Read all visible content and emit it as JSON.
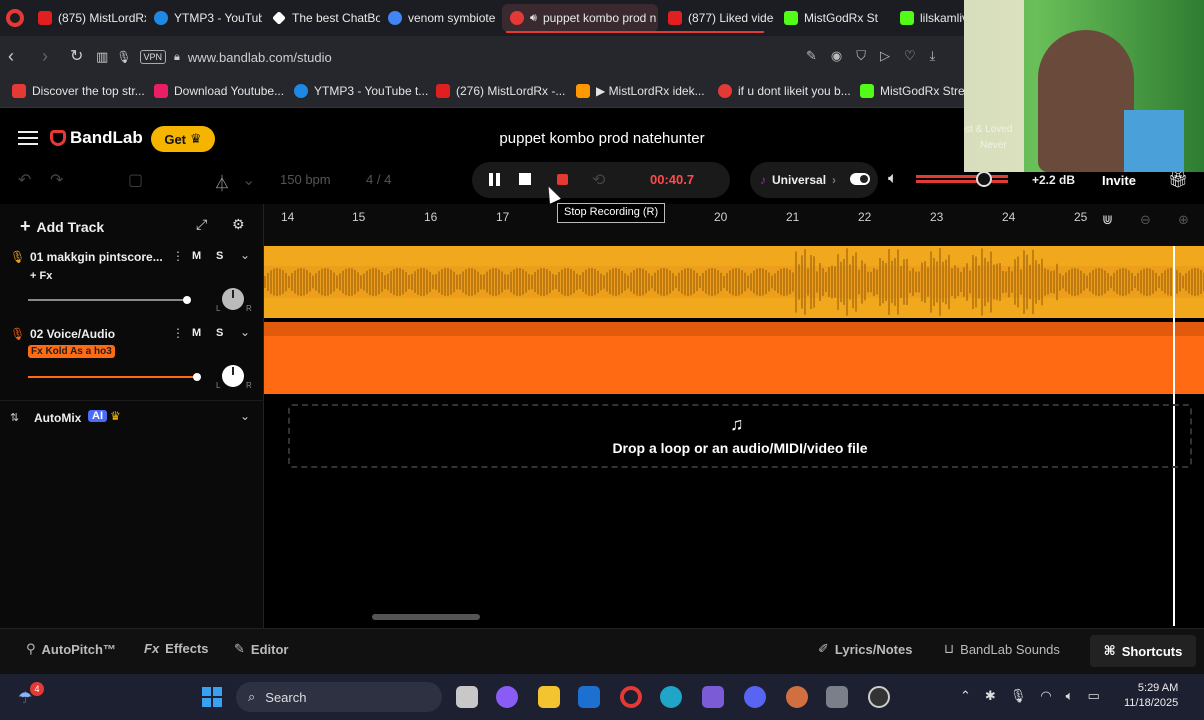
{
  "tabs": [
    {
      "label": "(875) MistLordRx",
      "color": "#e02020"
    },
    {
      "label": "YTMP3 - YouTube",
      "color": "#1e88e5"
    },
    {
      "label": "The best ChatBot",
      "color": "#ffffff"
    },
    {
      "label": "venom symbiote",
      "color": "#4285f4"
    },
    {
      "label": "puppet kombo prod n",
      "color": "#e53935"
    },
    {
      "label": "(877) Liked video",
      "color": "#e02020"
    },
    {
      "label": "MistGodRx St",
      "color": "#53fc18"
    },
    {
      "label": "lilskamlive St",
      "color": "#53fc18"
    }
  ],
  "address": {
    "url": "www.bandlab.com/studio",
    "vpn": "VPN"
  },
  "bookmarks": [
    {
      "label": "Discover the top str...",
      "color": "#e53935"
    },
    {
      "label": "Download Youtube...",
      "color": "#e91e63"
    },
    {
      "label": "YTMP3 - YouTube t...",
      "color": "#1e88e5"
    },
    {
      "label": "(276) MistLordRx -...",
      "color": "#e02020"
    },
    {
      "label": "▶ MistLordRx idek...",
      "color": "#ff9800"
    },
    {
      "label": "if u dont likeit you b...",
      "color": "#e53935"
    },
    {
      "label": "MistGodRx Stream",
      "color": "#53fc18"
    }
  ],
  "app": {
    "brand": "BandLab",
    "get_label": "Get",
    "project_title": "puppet kombo prod natehunter",
    "add_track": "Add Track",
    "invite": "Invite",
    "master_db": "+2.2 dB"
  },
  "toolbar": {
    "bpm": "150",
    "bpm_unit": "bpm",
    "time_sig": "4 / 4",
    "time": "00:40.7",
    "scale": "Universal",
    "tooltip": "Stop Recording (R)"
  },
  "ruler": [
    "14",
    "15",
    "16",
    "17",
    "",
    "",
    "20",
    "21",
    "22",
    "23",
    "24",
    "25"
  ],
  "tracks": [
    {
      "name": "01  makkgin pintscore...",
      "fx": "+ Fx",
      "mute": "M",
      "solo": "S",
      "pan_l": "L",
      "pan_r": "R"
    },
    {
      "name": "02  Voice/Audio",
      "fx": "Fx Kold As a ho3",
      "mute": "M",
      "solo": "S",
      "pan_l": "L",
      "pan_r": "R"
    }
  ],
  "automix": {
    "label": "AutoMix",
    "badge": "AI"
  },
  "dropzone": "Drop a loop or an audio/MIDI/video file",
  "bottom": {
    "autopitch": "AutoPitch™",
    "effects": "Effects",
    "editor": "Editor",
    "lyrics": "Lyrics/Notes",
    "sounds": "BandLab Sounds",
    "shortcuts": "Shortcuts"
  },
  "taskbar": {
    "search": "Search",
    "time": "5:29 AM",
    "date": "11/18/2025",
    "badge": "4"
  },
  "webcam": {
    "text1": "Lost & Loved",
    "text2": "Never"
  },
  "colors": {
    "accent": "#f5b400",
    "track1": "#f2a81d",
    "track2": "#ff6a13",
    "record": "#e53935",
    "time": "#ff4a4a"
  }
}
